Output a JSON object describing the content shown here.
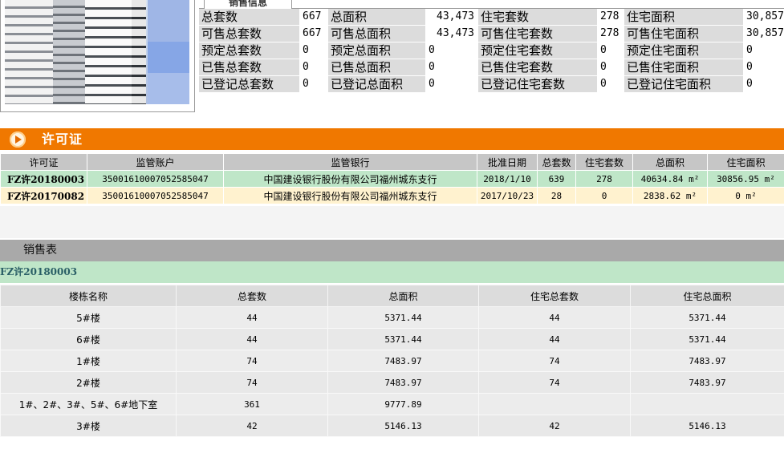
{
  "sales_info": {
    "tab_label": "销售信息",
    "rows": [
      [
        "总套数",
        "667",
        "总面积",
        "43,473",
        "住宅套数",
        "278",
        "住宅面积",
        "30,857"
      ],
      [
        "可售总套数",
        "667",
        "可售总面积",
        "43,473",
        "可售住宅套数",
        "278",
        "可售住宅面积",
        "30,857"
      ],
      [
        "预定总套数",
        "0",
        "预定总面积",
        "0",
        "预定住宅套数",
        "0",
        "预定住宅面积",
        "0"
      ],
      [
        "已售总套数",
        "0",
        "已售总面积",
        "0",
        "已售住宅套数",
        "0",
        "已售住宅面积",
        "0"
      ],
      [
        "已登记总套数",
        "0",
        "已登记总面积",
        "0",
        "已登记住宅套数",
        "0",
        "已登记住宅面积",
        "0"
      ]
    ]
  },
  "license": {
    "title": "许可证",
    "headers": [
      "许可证",
      "监管账户",
      "监管银行",
      "批准日期",
      "总套数",
      "住宅套数",
      "总面积",
      "住宅面积"
    ],
    "rows": [
      [
        "FZ许20180003",
        "35001610007052585047",
        "中国建设银行股份有限公司福州城东支行",
        "2018/1/10",
        "639",
        "278",
        "40634.84 m²",
        "30856.95 m²"
      ],
      [
        "FZ许20170082",
        "35001610007052585047",
        "中国建设银行股份有限公司福州城东支行",
        "2017/10/23",
        "28",
        "0",
        "2838.62 m²",
        "0 m²"
      ]
    ]
  },
  "sales_table": {
    "title": "销售表",
    "selected_license": "FZ许20180003",
    "headers": [
      "楼栋名称",
      "总套数",
      "总面积",
      "住宅总套数",
      "住宅总面积"
    ],
    "rows": [
      [
        "5#楼",
        "44",
        "5371.44",
        "44",
        "5371.44"
      ],
      [
        "6#楼",
        "44",
        "5371.44",
        "44",
        "5371.44"
      ],
      [
        "1#楼",
        "74",
        "7483.97",
        "74",
        "7483.97"
      ],
      [
        "2#楼",
        "74",
        "7483.97",
        "74",
        "7483.97"
      ],
      [
        "1#、2#、3#、5#、6#地下室",
        "361",
        "9777.89",
        "",
        ""
      ],
      [
        "3#楼",
        "42",
        "5146.13",
        "42",
        "5146.13"
      ]
    ]
  },
  "colors": {
    "accent_orange": "#f07800",
    "row_green": "#bfe6c8",
    "row_cream": "#fff2cf"
  }
}
